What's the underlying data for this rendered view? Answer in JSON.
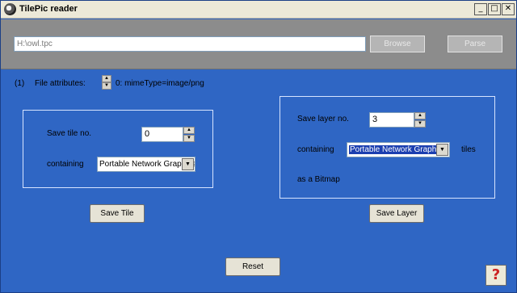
{
  "window": {
    "title": "TilePic reader",
    "controls": {
      "minimize": "_",
      "maximize": "□",
      "close": "✕"
    }
  },
  "file": {
    "path_value": "H:\\owl.tpc",
    "browse_label": "Browse",
    "parse_label": "Parse"
  },
  "attributes": {
    "count": "(1)",
    "label": "File attributes:",
    "value": "0: mimeType=image/png"
  },
  "tile_panel": {
    "save_label": "Save tile no.",
    "tile_no": "0",
    "containing_label": "containing",
    "format": "Portable Network Graphics",
    "button": "Save Tile"
  },
  "layer_panel": {
    "save_label": "Save layer no.",
    "layer_no": "3",
    "containing_label": "containing",
    "format": "Portable Network Graphics",
    "tiles_label": "tiles",
    "bitmap_label": "as a Bitmap",
    "button": "Save Layer"
  },
  "reset_label": "Reset",
  "help_label": "?",
  "icons": [
    "app-icon",
    "spin-up-icon",
    "spin-down-icon",
    "dropdown-arrow-icon",
    "help-icon"
  ]
}
